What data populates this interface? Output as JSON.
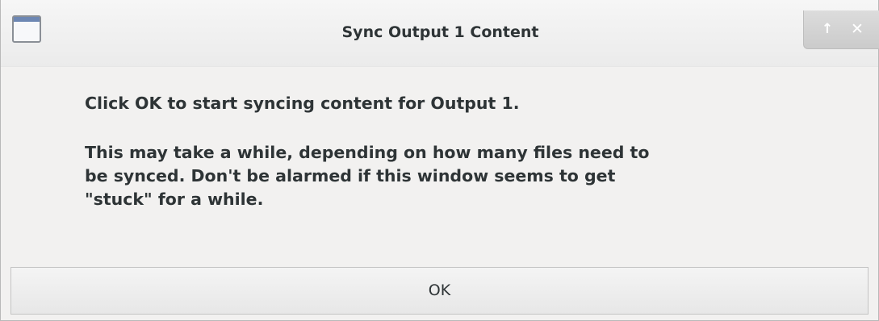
{
  "window": {
    "title": "Sync Output 1 Content"
  },
  "title_controls": {
    "shade_glyph": "↑",
    "close_glyph": "✕",
    "shade_icon": "arrow-up-icon",
    "close_icon": "close-icon"
  },
  "message": {
    "line1": "Click OK to start syncing content for Output 1.",
    "paragraph2_line1": "This may take a while, depending on how many files need to",
    "paragraph2_line2": "be synced.  Don't be alarmed if this window seems to get",
    "paragraph2_line3": "\"stuck\" for a while."
  },
  "buttons": {
    "ok_label": "OK"
  },
  "colors": {
    "text": "#2e3436",
    "window_bg": "#f2f1f0",
    "icon_accent": "#6d87b3"
  }
}
